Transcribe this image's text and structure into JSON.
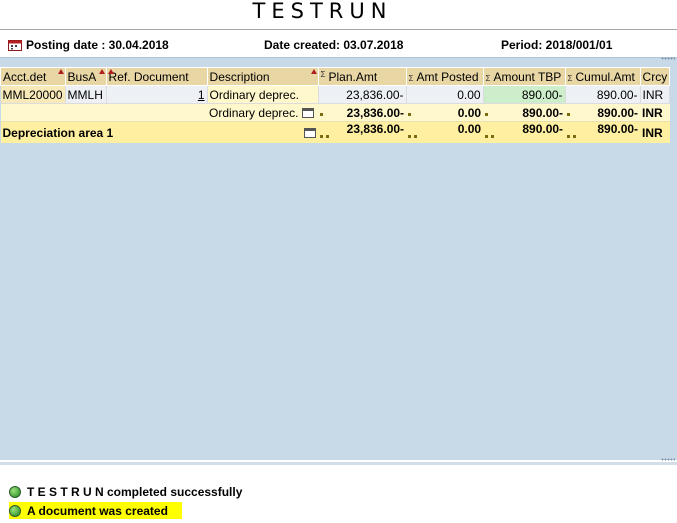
{
  "title": "TESTRUN",
  "info": {
    "posting_date": "Posting date : 30.04.2018",
    "date_created": "Date created: 03.07.2018",
    "period": "Period: 2018/001/01"
  },
  "columns": [
    "Acct.det",
    "BusA",
    "Ref. Document",
    "Description",
    "Plan.Amt",
    "Amt Posted",
    "Amount TBP",
    "Cumul.Amt",
    "Crcy"
  ],
  "rows": [
    {
      "acct": "MML20000",
      "busa": "MMLH",
      "ref": "1",
      "desc": "Ordinary deprec.",
      "plan": "23,836.00-",
      "posted": "0.00",
      "tbp": "890.00-",
      "cumul": "890.00-",
      "crcy": "INR"
    }
  ],
  "subtotal": {
    "desc": "Ordinary deprec.",
    "plan": "23,836.00-",
    "posted": "0.00",
    "tbp": "890.00-",
    "cumul": "890.00-",
    "crcy": "INR"
  },
  "total": {
    "label": "Depreciation area  1",
    "plan": "23,836.00-",
    "posted": "0.00",
    "tbp": "890.00-",
    "cumul": "890.00-",
    "crcy": "INR"
  },
  "messages": [
    {
      "text": "T E S T R U N completed successfully"
    },
    {
      "text": "A document was created"
    }
  ]
}
